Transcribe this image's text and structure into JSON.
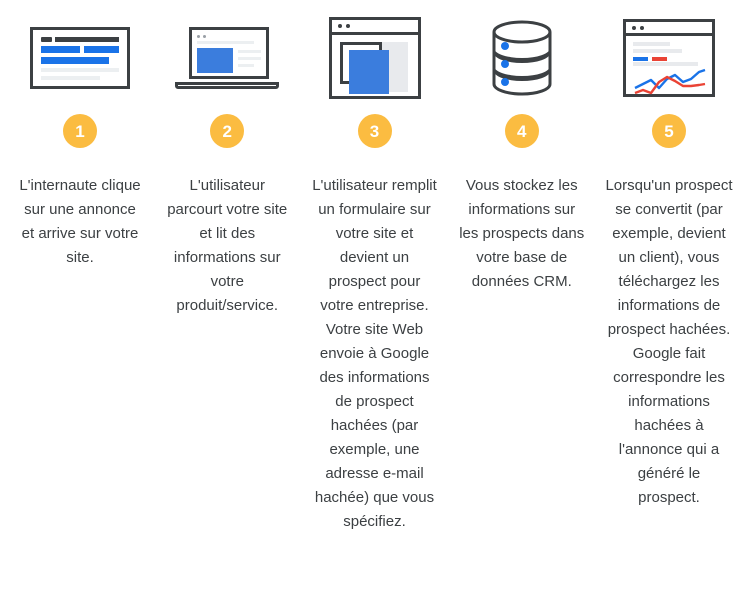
{
  "colors": {
    "badge": "#fbbc41",
    "ink": "#3c4043",
    "blue": "#1a73e8",
    "blue_fill": "#3b7ddd",
    "red": "#ea4335",
    "grey_fill": "#e8eaed",
    "background": "#ffffff"
  },
  "steps": [
    {
      "number": "1",
      "icon": "search-ad-page-icon",
      "caption": "L'internaute clique sur une annonce et arrive sur votre site."
    },
    {
      "number": "2",
      "icon": "laptop-website-icon",
      "caption": "L'utilisateur parcourt votre site et lit des informations sur votre produit/service."
    },
    {
      "number": "3",
      "icon": "form-window-icon",
      "caption": "L'utilisateur remplit un formulaire sur votre site et devient un prospect pour votre entreprise. Votre site Web envoie à Google des informations de prospect hachées (par exemple, une adresse e-mail hachée) que vous spécifiez."
    },
    {
      "number": "4",
      "icon": "database-icon",
      "caption": "Vous stockez les informations sur les prospects dans votre base de données CRM."
    },
    {
      "number": "5",
      "icon": "analytics-chart-window-icon",
      "caption": "Lorsqu'un prospect se convertit (par exemple, devient un client), vous téléchargez les informations de prospect hachées. Google fait correspondre les informations hachées à l'annonce qui a généré le prospect."
    }
  ]
}
